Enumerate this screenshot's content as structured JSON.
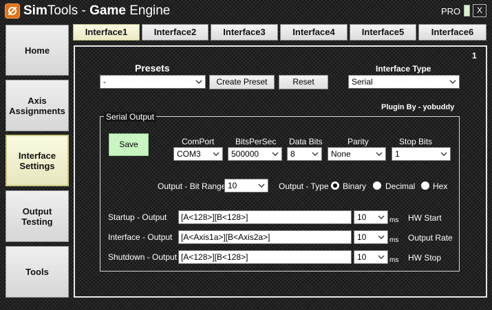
{
  "window": {
    "title_part1": "Sim",
    "title_part2": "Tools - ",
    "title_part3": "Game",
    "title_part4": " Engine",
    "pro_label": "PRO",
    "close_label": "X"
  },
  "nav": {
    "home": "Home",
    "axis_line1": "Axis",
    "axis_line2": "Assignments",
    "interface_line1": "Interface",
    "interface_line2": "Settings",
    "output_line1": "Output",
    "output_line2": "Testing",
    "tools": "Tools"
  },
  "tabs": [
    "Interface1",
    "Interface2",
    "Interface3",
    "Interface4",
    "Interface5",
    "Interface6"
  ],
  "panel": {
    "page_number": "1",
    "presets_label": "Presets",
    "preset_value": "-",
    "create_preset_label": "Create Preset",
    "reset_label": "Reset",
    "interface_type_label": "Interface Type",
    "interface_type_value": "Serial",
    "plugin_by": "Plugin By - yobuddy"
  },
  "serial": {
    "group_label": "Serial Output",
    "save_label": "Save",
    "comport_label": "ComPort",
    "comport_value": "COM3",
    "bps_label": "BitsPerSec",
    "bps_value": "500000",
    "databits_label": "Data Bits",
    "databits_value": "8",
    "parity_label": "Parity",
    "parity_value": "None",
    "stopbits_label": "Stop Bits",
    "stopbits_value": "1",
    "bitrange_label": "Output - Bit Range",
    "bitrange_value": "10",
    "type_label": "Output - Type",
    "type_binary": "Binary",
    "type_decimal": "Decimal",
    "type_hex": "Hex",
    "selected_type": "Binary"
  },
  "outputs": {
    "startup_label": "Startup - Output",
    "startup_value": "[A<128>][B<128>]",
    "startup_ms": "10",
    "interface_label": "Interface - Output",
    "interface_value": "[A<Axis1a>][B<Axis2a>]",
    "interface_ms": "10",
    "shutdown_label": "Shutdown - Output",
    "shutdown_value": "[A<128>][B<128>]",
    "shutdown_ms": "10",
    "ms_unit": "ms",
    "hw_start": "HW Start",
    "output_rate": "Output Rate",
    "hw_stop": "HW Stop"
  }
}
